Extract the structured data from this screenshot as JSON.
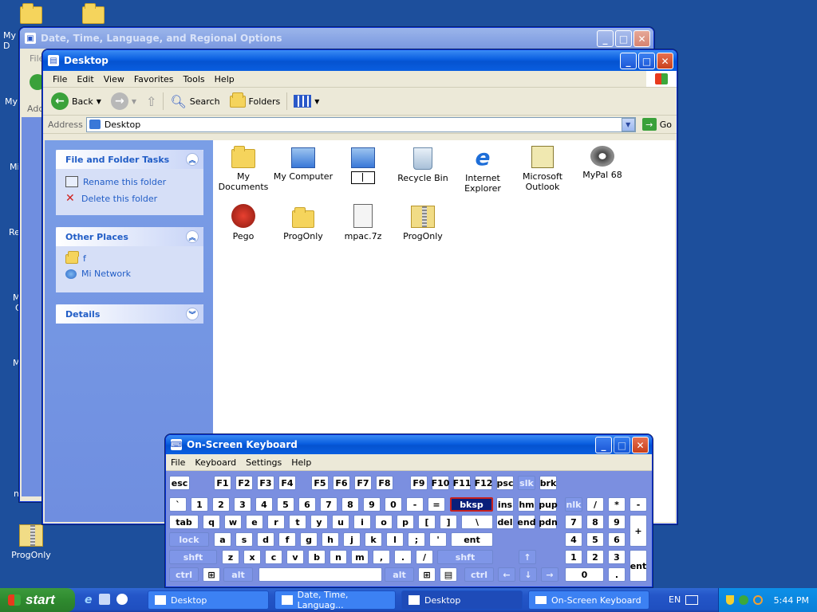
{
  "desktop": {
    "left_labels": [
      "My D",
      "My",
      "Mi",
      "Re",
      "M",
      "C",
      "M",
      "n"
    ],
    "progonly_label": "ProgOnly"
  },
  "back_window": {
    "title": "Date, Time, Language, and Regional Options",
    "menu_partial": "File",
    "addr_partial": "Addr"
  },
  "explorer": {
    "title": "Desktop",
    "menu": [
      "File",
      "Edit",
      "View",
      "Favorites",
      "Tools",
      "Help"
    ],
    "toolbar": {
      "back": "Back",
      "search": "Search",
      "folders": "Folders"
    },
    "address_label": "Address",
    "address_value": "Desktop",
    "go_label": "Go",
    "tasks": {
      "title": "File and Folder Tasks",
      "items": [
        "Rename this folder",
        "Delete this folder"
      ]
    },
    "other_places": {
      "title": "Other Places",
      "items": [
        "f",
        "Mi Network"
      ]
    },
    "details": {
      "title": "Details"
    },
    "files": [
      {
        "label": "My Documents",
        "icon": "my-documents-icon"
      },
      {
        "label": "My Computer",
        "icon": "my-computer-icon"
      },
      {
        "label": "",
        "icon": "network-icon"
      },
      {
        "label": "Recycle Bin",
        "icon": "recycle-bin-icon"
      },
      {
        "label": "Internet Explorer",
        "icon": "internet-explorer-icon"
      },
      {
        "label": "Microsoft Outlook",
        "icon": "outlook-icon"
      },
      {
        "label": "MyPal 68",
        "icon": "mypal-icon"
      },
      {
        "label": "Pego",
        "icon": "pego-icon"
      },
      {
        "label": "ProgOnly",
        "icon": "folder-icon"
      },
      {
        "label": "mpac.7z",
        "icon": "archive-icon"
      },
      {
        "label": "ProgOnly",
        "icon": "zip-folder-icon"
      }
    ]
  },
  "osk": {
    "title": "On-Screen Keyboard",
    "menu": [
      "File",
      "Keyboard",
      "Settings",
      "Help"
    ],
    "row1": [
      "esc",
      "F1",
      "F2",
      "F3",
      "F4",
      "F5",
      "F6",
      "F7",
      "F8",
      "F9",
      "F10",
      "F11",
      "F12",
      "psc",
      "slk",
      "brk"
    ],
    "row2": [
      "`",
      "1",
      "2",
      "3",
      "4",
      "5",
      "6",
      "7",
      "8",
      "9",
      "0",
      "-",
      "=",
      "bksp",
      "ins",
      "hm",
      "pup",
      "nlk",
      "/",
      "*",
      "-"
    ],
    "row3": [
      "tab",
      "q",
      "w",
      "e",
      "r",
      "t",
      "y",
      "u",
      "i",
      "o",
      "p",
      "[",
      "]",
      "\\",
      "del",
      "end",
      "pdn",
      "7",
      "8",
      "9",
      "+"
    ],
    "row4": [
      "lock",
      "a",
      "s",
      "d",
      "f",
      "g",
      "h",
      "j",
      "k",
      "l",
      ";",
      "'",
      "ent",
      "4",
      "5",
      "6"
    ],
    "row5": [
      "shft",
      "z",
      "x",
      "c",
      "v",
      "b",
      "n",
      "m",
      ",",
      ".",
      "/",
      "shft",
      "↑",
      "1",
      "2",
      "3",
      "ent"
    ],
    "row6": [
      "ctrl",
      "alt",
      "alt",
      "ctrl",
      "←",
      "↓",
      "→",
      "0",
      "."
    ]
  },
  "taskbar": {
    "start_label": "start",
    "tasks": [
      "Desktop",
      "Date, Time, Languag...",
      "Desktop",
      "On-Screen Keyboard"
    ],
    "lang": "EN",
    "clock": "5:44 PM"
  }
}
